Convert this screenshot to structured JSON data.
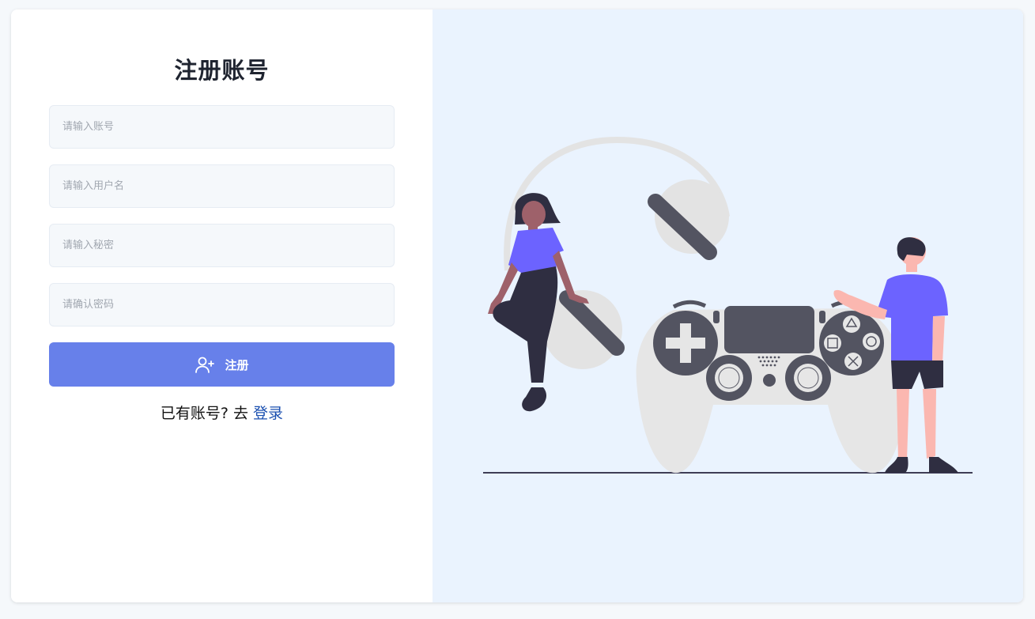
{
  "form": {
    "title": "注册账号",
    "account_placeholder": "请输入账号",
    "username_placeholder": "请输入用户名",
    "password_placeholder": "请输入秘密",
    "confirm_placeholder": "请确认密码",
    "submit_label": "注册",
    "submit_icon": "user-plus-icon",
    "have_account_text": "已有账号? 去",
    "login_link": "登录"
  },
  "colors": {
    "primary_button": "#6780ea",
    "link": "#1a4fb0",
    "illustration_bg": "#eaf3fe",
    "accent_purple": "#6c63ff"
  },
  "illustration": {
    "name": "gaming-controller-illustration"
  }
}
